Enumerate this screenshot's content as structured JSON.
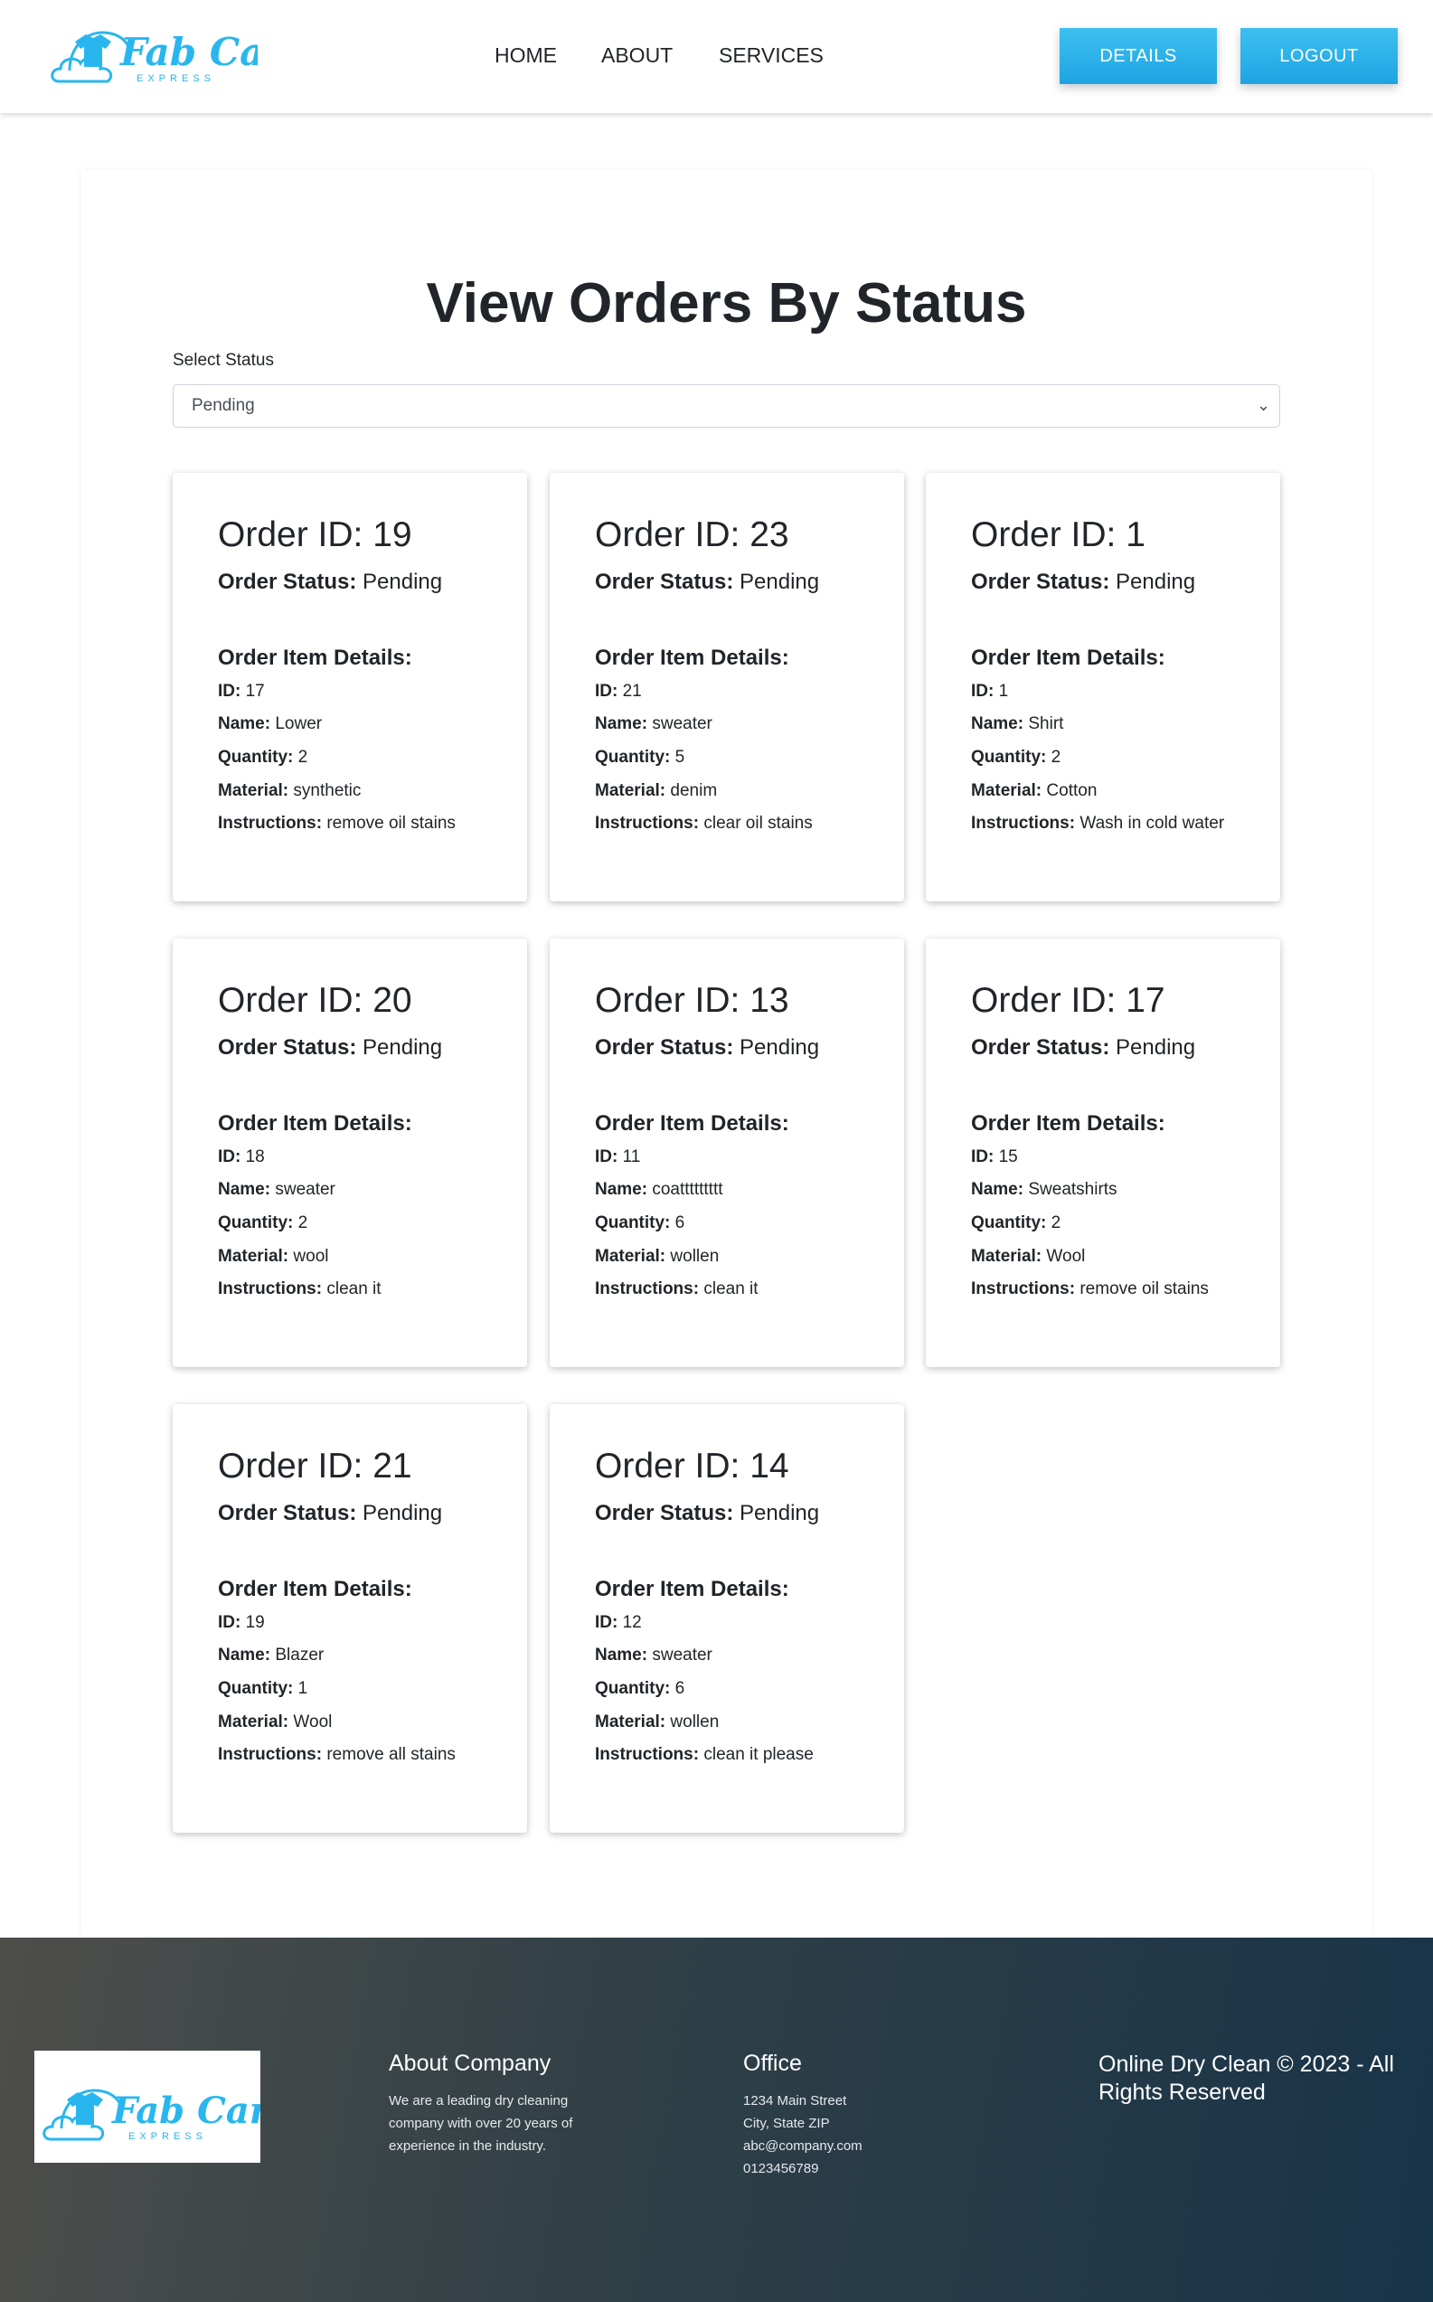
{
  "brand": {
    "name": "Fab Care",
    "tagline": "EXPRESS",
    "accent": "#29b6ee"
  },
  "nav": {
    "home": "HOME",
    "about": "ABOUT",
    "services": "SERVICES"
  },
  "buttons": {
    "details": "DETAILS",
    "logout": "LOGOUT"
  },
  "page": {
    "title": "View Orders By Status",
    "select_label": "Select Status",
    "selected_status": "Pending"
  },
  "labels": {
    "order_id": "Order ID:",
    "order_status": "Order Status:",
    "item_details": "Order Item Details:",
    "id": "ID:",
    "name": "Name:",
    "quantity": "Quantity:",
    "material": "Material:",
    "instructions": "Instructions:"
  },
  "orders": [
    {
      "order_id": "19",
      "status": "Pending",
      "item": {
        "id": "17",
        "name": "Lower",
        "quantity": "2",
        "material": "synthetic",
        "instructions": "remove oil stains"
      }
    },
    {
      "order_id": "23",
      "status": "Pending",
      "item": {
        "id": "21",
        "name": "sweater",
        "quantity": "5",
        "material": "denim",
        "instructions": "clear oil stains"
      }
    },
    {
      "order_id": "1",
      "status": "Pending",
      "item": {
        "id": "1",
        "name": "Shirt",
        "quantity": "2",
        "material": "Cotton",
        "instructions": "Wash in cold water"
      }
    },
    {
      "order_id": "20",
      "status": "Pending",
      "item": {
        "id": "18",
        "name": "sweater",
        "quantity": "2",
        "material": "wool",
        "instructions": "clean it"
      }
    },
    {
      "order_id": "13",
      "status": "Pending",
      "item": {
        "id": "11",
        "name": "coattttttttt",
        "quantity": "6",
        "material": "wollen",
        "instructions": "clean it"
      }
    },
    {
      "order_id": "17",
      "status": "Pending",
      "item": {
        "id": "15",
        "name": "Sweatshirts",
        "quantity": "2",
        "material": "Wool",
        "instructions": "remove oil stains"
      }
    },
    {
      "order_id": "21",
      "status": "Pending",
      "item": {
        "id": "19",
        "name": "Blazer",
        "quantity": "1",
        "material": "Wool",
        "instructions": "remove all stains"
      }
    },
    {
      "order_id": "14",
      "status": "Pending",
      "item": {
        "id": "12",
        "name": "sweater",
        "quantity": "6",
        "material": "wollen",
        "instructions": "clean it please"
      }
    }
  ],
  "footer": {
    "about_title": "About Company",
    "about_text": "We are a leading dry cleaning company with over 20 years of experience in the industry.",
    "office_title": "Office",
    "office_address": "1234 Main Street",
    "office_city": "City, State ZIP",
    "office_email": "abc@company.com",
    "office_phone": "0123456789",
    "copyright": "Online Dry Clean © 2023 - All Rights Reserved"
  }
}
